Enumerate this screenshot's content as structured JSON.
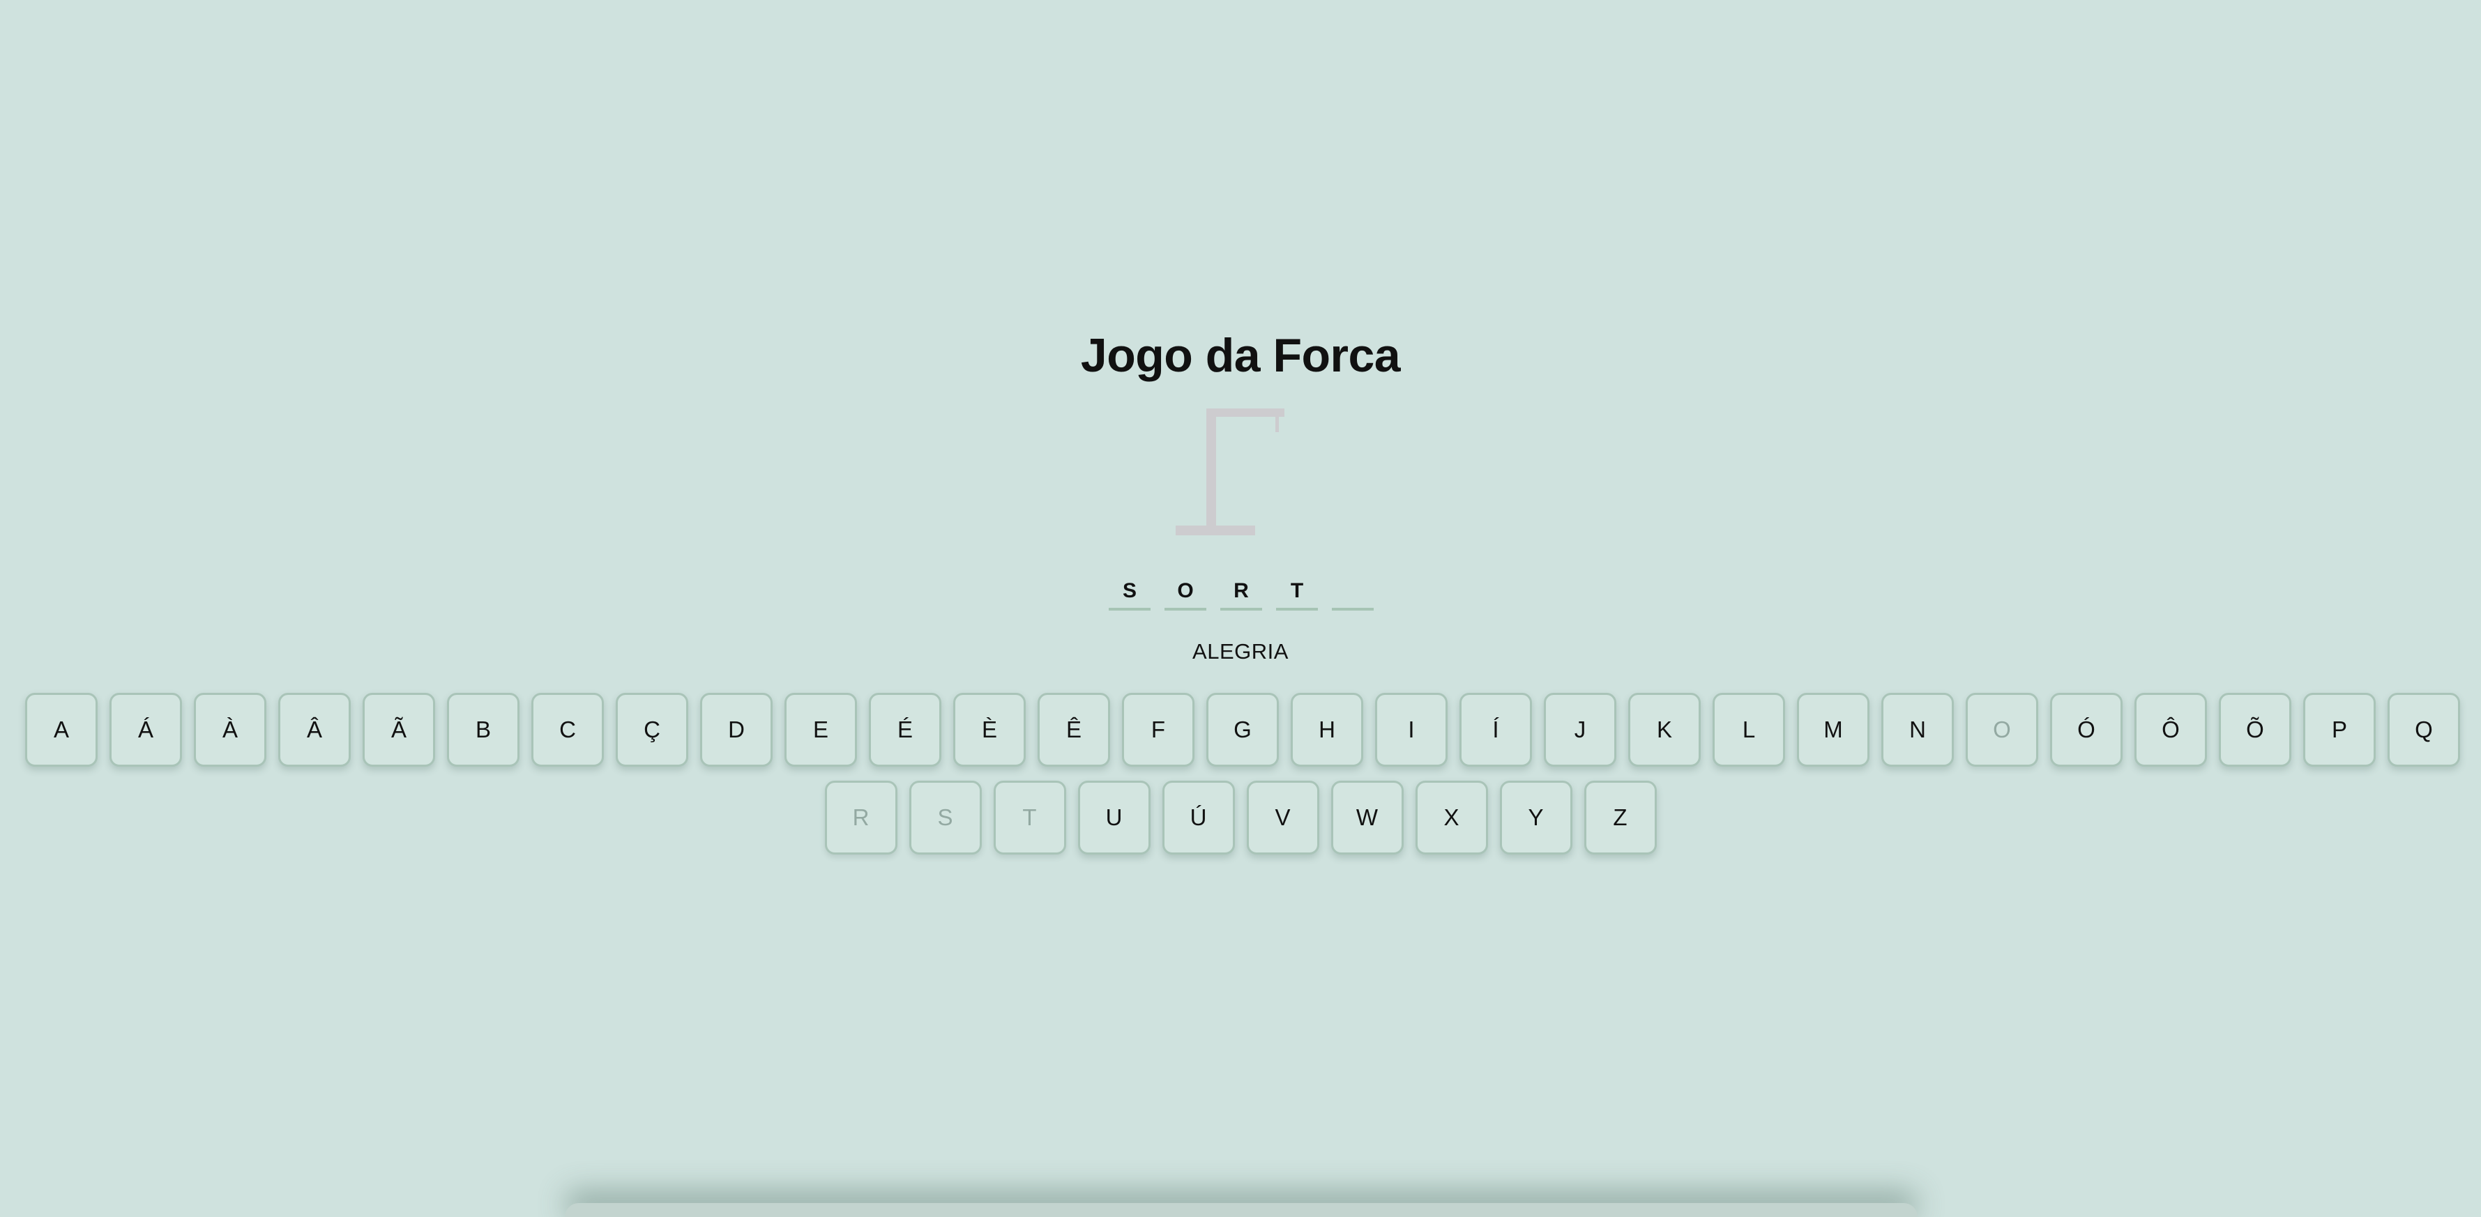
{
  "title": "Jogo da Forca",
  "word": {
    "slots": [
      "S",
      "O",
      "R",
      "T",
      ""
    ]
  },
  "hint": "ALEGRIA",
  "keyboard": {
    "row1": [
      {
        "label": "A",
        "used": false
      },
      {
        "label": "Á",
        "used": false
      },
      {
        "label": "À",
        "used": false
      },
      {
        "label": "Â",
        "used": false
      },
      {
        "label": "Ã",
        "used": false
      },
      {
        "label": "B",
        "used": false
      },
      {
        "label": "C",
        "used": false
      },
      {
        "label": "Ç",
        "used": false
      },
      {
        "label": "D",
        "used": false
      },
      {
        "label": "E",
        "used": false
      },
      {
        "label": "É",
        "used": false
      },
      {
        "label": "È",
        "used": false
      },
      {
        "label": "Ê",
        "used": false
      },
      {
        "label": "F",
        "used": false
      },
      {
        "label": "G",
        "used": false
      },
      {
        "label": "H",
        "used": false
      },
      {
        "label": "I",
        "used": false
      },
      {
        "label": "Í",
        "used": false
      },
      {
        "label": "J",
        "used": false
      },
      {
        "label": "K",
        "used": false
      },
      {
        "label": "L",
        "used": false
      },
      {
        "label": "M",
        "used": false
      },
      {
        "label": "N",
        "used": false
      },
      {
        "label": "O",
        "used": true
      },
      {
        "label": "Ó",
        "used": false
      },
      {
        "label": "Ô",
        "used": false
      },
      {
        "label": "Õ",
        "used": false
      },
      {
        "label": "P",
        "used": false
      },
      {
        "label": "Q",
        "used": false
      }
    ],
    "row2": [
      {
        "label": "R",
        "used": true
      },
      {
        "label": "S",
        "used": true
      },
      {
        "label": "T",
        "used": true
      },
      {
        "label": "U",
        "used": false
      },
      {
        "label": "Ú",
        "used": false
      },
      {
        "label": "V",
        "used": false
      },
      {
        "label": "W",
        "used": false
      },
      {
        "label": "X",
        "used": false
      },
      {
        "label": "Y",
        "used": false
      },
      {
        "label": "Z",
        "used": false
      }
    ]
  },
  "colors": {
    "background": "#cfe2de",
    "gallows": "#cdcccf",
    "key_border": "#a9c4b8",
    "used_key_text": "#93a9a2"
  }
}
